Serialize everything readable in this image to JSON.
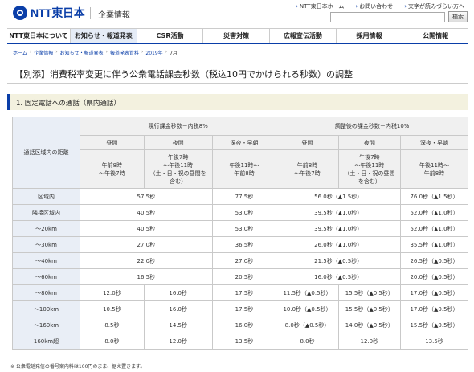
{
  "header": {
    "logo_text": "NTT東日本",
    "corp_label": "企業情報",
    "util_links": [
      "NTT東日本ホーム",
      "お問い合わせ",
      "文字が読みづらい方へ"
    ],
    "search_button": "検索"
  },
  "nav": {
    "items": [
      "NTT東日本について",
      "お知らせ・報道発表",
      "CSR活動",
      "災害対策",
      "広報宣伝活動",
      "採用情報",
      "公開情報"
    ],
    "active_index": 1
  },
  "breadcrumb": [
    "ホーム",
    "企業情報",
    "お知らせ・報道発表",
    "報道発表資料",
    "2019年",
    "7月"
  ],
  "page_title": "【別添】消費税率変更に伴う公衆電話課金秒数（税込10円でかけられる秒数）の調整",
  "section_heading": "1. 固定電話への通話（県内通話）",
  "table": {
    "corner": "通話区域内の距離",
    "group_current": "現行課金秒数－内税8%",
    "group_new": "調整後の課金秒数－内税10%",
    "col_headers": [
      "昼間",
      "夜間",
      "深夜・早朝",
      "昼間",
      "夜間",
      "深夜・早朝"
    ],
    "col_times": [
      "午前8時\n～午後7時",
      "午後7時\n～午後11時\n（土・日・祝の昼間を\n含む）",
      "午後11時～\n午前8時",
      "午前8時\n～午後7時",
      "午後7時\n～午後11時\n（土・日・祝の昼間\nを含む）",
      "午後11時～\n午前8時"
    ],
    "rows": [
      {
        "label": "区域内",
        "cur_day_night": "57.5秒",
        "cur_late": "77.5秒",
        "new_day_night": "56.0秒（▲1.5秒）",
        "new_late": "76.0秒（▲1.5秒）"
      },
      {
        "label": "隣接区域内",
        "cur_day_night": "40.5秒",
        "cur_late": "53.0秒",
        "new_day_night": "39.5秒（▲1.0秒）",
        "new_late": "52.0秒（▲1.0秒）"
      },
      {
        "label": "～20km",
        "cur_day_night": "40.5秒",
        "cur_late": "53.0秒",
        "new_day_night": "39.5秒（▲1.0秒）",
        "new_late": "52.0秒（▲1.0秒）"
      },
      {
        "label": "～30km",
        "cur_day_night": "27.0秒",
        "cur_late": "36.5秒",
        "new_day_night": "26.0秒（▲1.0秒）",
        "new_late": "35.5秒（▲1.0秒）"
      },
      {
        "label": "～40km",
        "cur_day_night": "22.0秒",
        "cur_late": "27.0秒",
        "new_day_night": "21.5秒（▲0.5秒）",
        "new_late": "26.5秒（▲0.5秒）"
      },
      {
        "label": "～60km",
        "cur_day_night": "16.5秒",
        "cur_late": "20.5秒",
        "new_day_night": "16.0秒（▲0.5秒）",
        "new_late": "20.0秒（▲0.5秒）"
      }
    ],
    "rows_split": [
      {
        "label": "～80km",
        "cur_day": "12.0秒",
        "cur_night": "16.0秒",
        "cur_late": "17.5秒",
        "new_day": "11.5秒（▲0.5秒）",
        "new_night": "15.5秒（▲0.5秒）",
        "new_late": "17.0秒（▲0.5秒）"
      },
      {
        "label": "～100km",
        "cur_day": "10.5秒",
        "cur_night": "16.0秒",
        "cur_late": "17.5秒",
        "new_day": "10.0秒（▲0.5秒）",
        "new_night": "15.5秒（▲0.5秒）",
        "new_late": "17.0秒（▲0.5秒）"
      },
      {
        "label": "～160km",
        "cur_day": "8.5秒",
        "cur_night": "14.5秒",
        "cur_late": "16.0秒",
        "new_day": "8.0秒（▲0.5秒）",
        "new_night": "14.0秒（▲0.5秒）",
        "new_late": "15.5秒（▲0.5秒）"
      },
      {
        "label": "160km超",
        "cur_day": "8.0秒",
        "cur_night": "12.0秒",
        "cur_late": "13.5秒",
        "new_day": "8.0秒",
        "new_night": "12.0秒",
        "new_late": "13.5秒"
      }
    ]
  },
  "footnote": "※ 公衆電話発信の番号案内料は100円のまま、据え置きます。"
}
